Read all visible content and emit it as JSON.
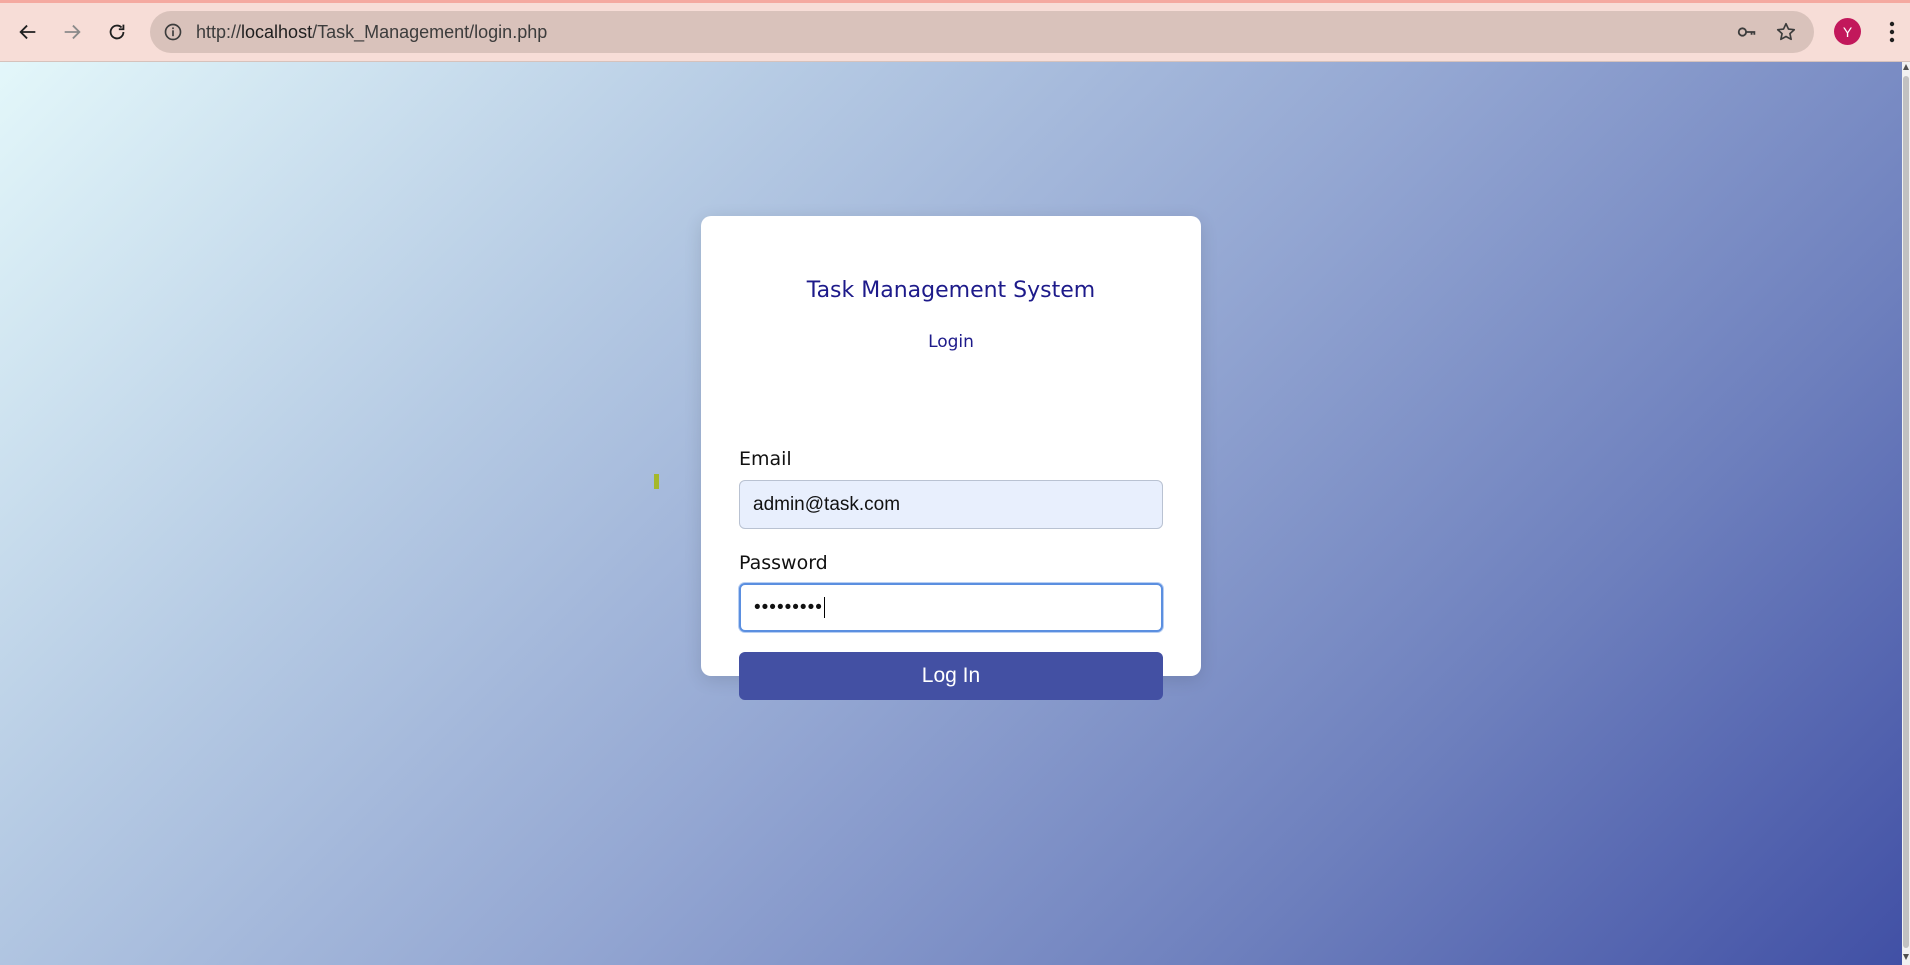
{
  "browser": {
    "url_prefix": "http://",
    "url_host": "localhost",
    "url_path": "/Task_Management/login.php",
    "avatar_initial": "Y",
    "icons": {
      "back": "back-arrow-icon",
      "forward": "forward-arrow-icon",
      "reload": "reload-icon",
      "site_info": "info-icon",
      "password_key": "key-icon",
      "bookmark": "star-icon",
      "menu": "kebab-menu-icon"
    }
  },
  "login": {
    "title": "Task Management System",
    "subtitle": "Login",
    "email_label": "Email",
    "email_value": "admin@task.com",
    "password_label": "Password",
    "password_masked": "•••••••••",
    "submit_label": "Log In"
  },
  "colors": {
    "title": "#1d1a8a",
    "button": "#4350a3",
    "gradient_start": "#e3f7fa",
    "gradient_end": "#4150a5",
    "avatar": "#c2185b"
  }
}
